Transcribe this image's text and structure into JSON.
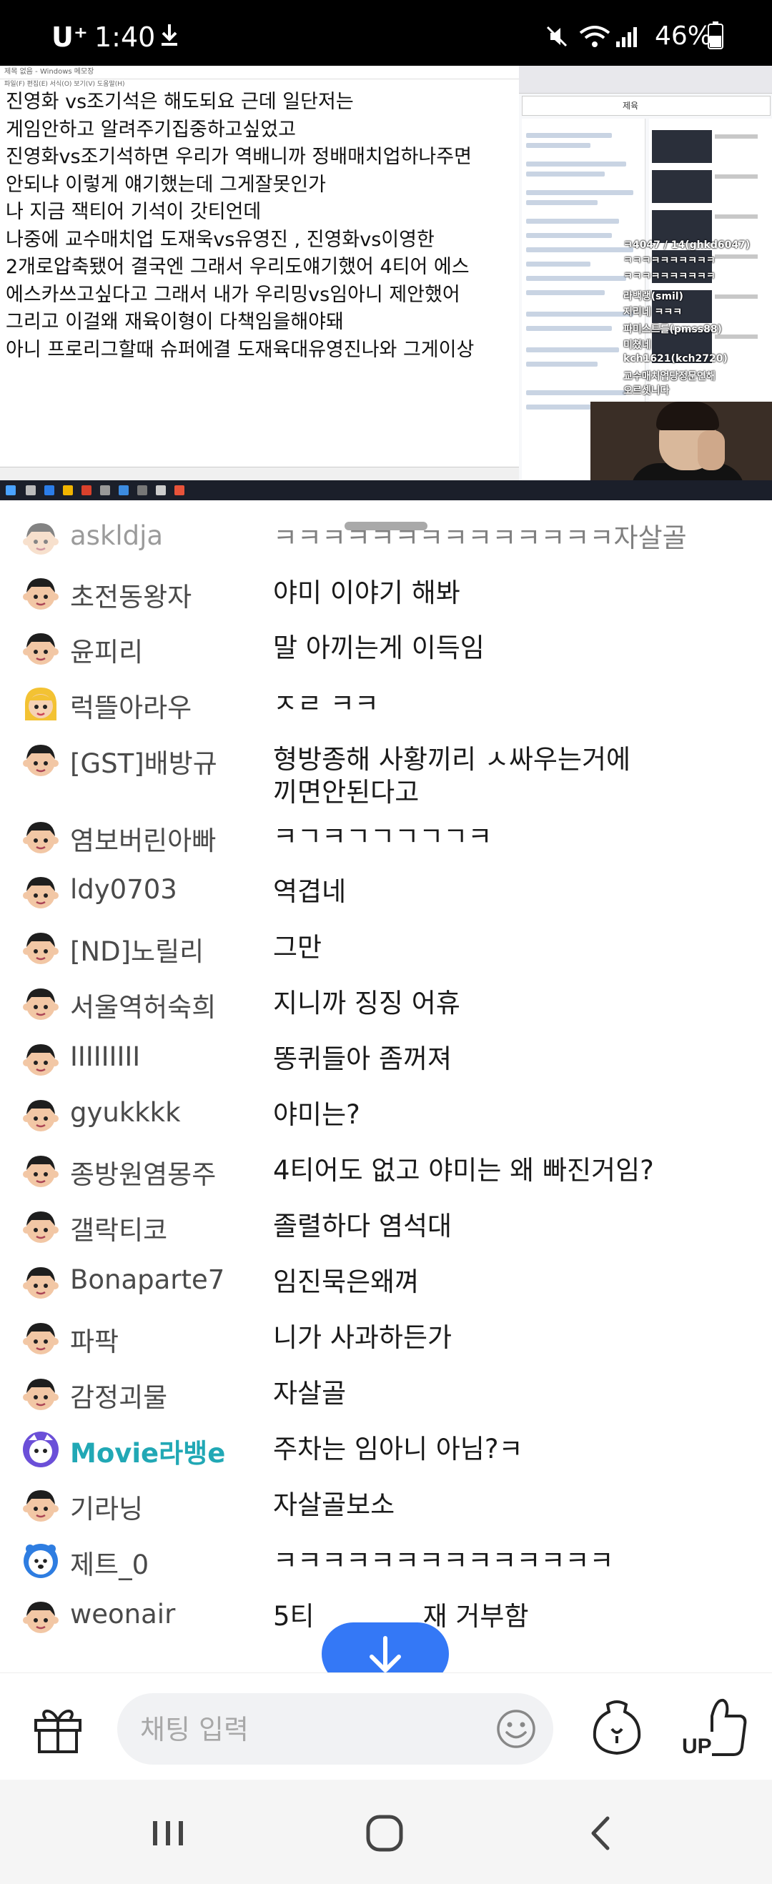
{
  "status_bar": {
    "carrier": "U⁺",
    "time": "1:40",
    "battery": "46%"
  },
  "video": {
    "notepad_title": "제목 없음 - Windows 메모장",
    "notepad_lines": [
      "진영화 vs조기석은 해도되요 근데 일단저는",
      "게임안하고 알려주기집중하고싶었고",
      "진영화vs조기석하면 우리가 역배니까 정배매치업하나주면",
      "안되냐 이렇게 얘기했는데 그게잘못인가",
      "나 지금 잭티어 기석이 갓티언데",
      "나중에 교수매치업 도재욱vs유영진 , 진영화vs이영한",
      "2개로압축됐어 결국엔 그래서 우리도얘기했어 4티어 에스",
      "에스카쓰고싶다고 그래서 내가 우리밍vs임아니 제안했어",
      "그리고 이걸왜 재육이형이 다책임을해야돼",
      "아니 프로리그할때 슈퍼에결 도재육대유영진나와 그게이상"
    ],
    "browser_search": "제육",
    "overlay": {
      "line1": "ㅋ4047 / 14(ghkd6047)",
      "line2": "ㅋㅋㅋㅋㅋㅋㅋㅋㅋㅋ",
      "line3": "ㅋㅋㅋㅋㅋㅋㅋㅋㅋㅋ",
      "line4": "라백랭(smil)",
      "line5": "지리네 ㅋㅋㅋ",
      "line6": "파미스트를(pmss88)",
      "line7": "미쳤네",
      "line8": "kch1621(kch2720)",
      "line9": "교수매치업당정문연해",
      "line10": "오르셋니다"
    }
  },
  "chat": {
    "messages": [
      {
        "nick": "askldja",
        "text": "ㅋㅋㅋㅋㅋㅋㅋㅋㅋㅋㅋㅋㅋㅋ자살골",
        "avatar": "default"
      },
      {
        "nick": "초전동왕자",
        "text": "야미 이야기 해봐",
        "avatar": "default"
      },
      {
        "nick": "윤피리",
        "text": "말 아끼는게 이득임",
        "avatar": "default"
      },
      {
        "nick": "럭뜰아라우",
        "text": "ㅈㄹ ㅋㅋ",
        "avatar": "blonde"
      },
      {
        "nick": "[GST]배방규",
        "text": "형방종해 사황끼리 ㅅ싸우는거에",
        "text2": "끼면안된다고",
        "avatar": "default"
      },
      {
        "nick": "염보버린아빠",
        "text": "ㅋㄱㅋㄱㄱㄱㄱㄱㅋ",
        "avatar": "default"
      },
      {
        "nick": "ldy0703",
        "text": "역겹네",
        "avatar": "default"
      },
      {
        "nick": "[ND]노릴리",
        "text": "그만",
        "avatar": "default"
      },
      {
        "nick": "서울역허숙희",
        "text": "지니까 징징 어휴",
        "avatar": "default"
      },
      {
        "nick": "IIIIIIIII",
        "text": "똥퀴들아 좀꺼져",
        "avatar": "default"
      },
      {
        "nick": "gyukkkk",
        "text": "야미는?",
        "avatar": "default"
      },
      {
        "nick": "종방원염몽주",
        "text": "4티어도 없고 야미는 왜 빠진거임?",
        "avatar": "default"
      },
      {
        "nick": "갤락티코",
        "text": "졸렬하다 염석대",
        "avatar": "default"
      },
      {
        "nick": "Bonaparte7",
        "text": "임진묵은왜껴",
        "avatar": "default"
      },
      {
        "nick": "파팍",
        "text": "니가 사과하든가",
        "avatar": "default"
      },
      {
        "nick": "감정괴물",
        "text": "자살골",
        "avatar": "default"
      },
      {
        "nick": "Movie라뱅e",
        "text": "주차는 임아니 아님?ㅋ",
        "avatar": "purple",
        "special": true
      },
      {
        "nick": "기라닝",
        "text": "자살골보소",
        "avatar": "default"
      },
      {
        "nick": "제트_0",
        "text": "ㅋㅋㅋㅋㅋㅋㅋㅋㅋㅋㅋㅋㅋㅋ",
        "avatar": "bear"
      },
      {
        "nick": "weonair",
        "text": "5티",
        "text_after": "재 거부함",
        "avatar": "default"
      }
    ]
  },
  "input": {
    "placeholder": "채팅 입력",
    "up_label": "UP"
  },
  "colors": {
    "accent_blue": "#3478f6",
    "special_nick": "#21a8b5",
    "purple_avatar": "#6b4fd8"
  }
}
